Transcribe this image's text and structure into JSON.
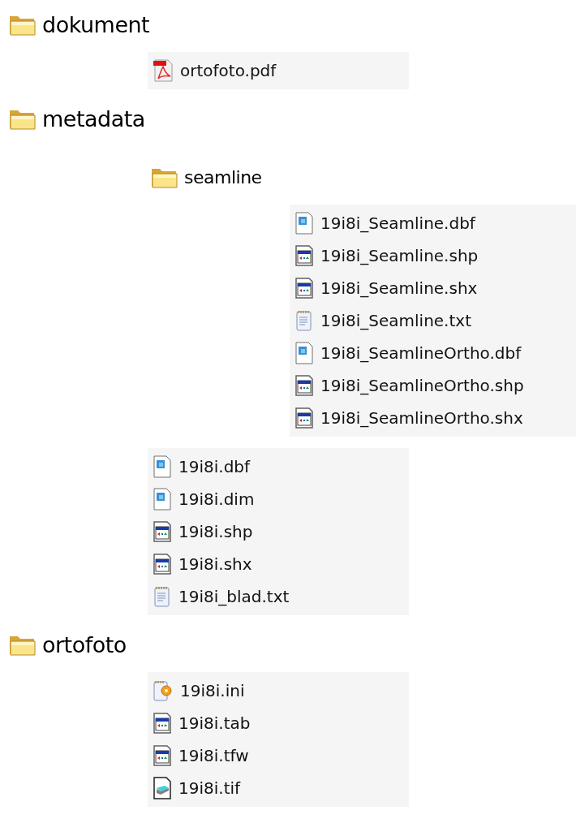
{
  "tree": [
    {
      "name": "dokument",
      "files": [
        {
          "name": "ortofoto.pdf",
          "kind": "pdf"
        }
      ]
    },
    {
      "name": "metadata",
      "children": [
        {
          "name": "seamline",
          "files": [
            {
              "name": "19i8i_Seamline.dbf",
              "kind": "dbf"
            },
            {
              "name": "19i8i_Seamline.shp",
              "kind": "map"
            },
            {
              "name": "19i8i_Seamline.shx",
              "kind": "map"
            },
            {
              "name": "19i8i_Seamline.txt",
              "kind": "txt"
            },
            {
              "name": "19i8i_SeamlineOrtho.dbf",
              "kind": "dbf"
            },
            {
              "name": "19i8i_SeamlineOrtho.shp",
              "kind": "map"
            },
            {
              "name": "19i8i_SeamlineOrtho.shx",
              "kind": "map"
            }
          ]
        }
      ],
      "files": [
        {
          "name": "19i8i.dbf",
          "kind": "dbf"
        },
        {
          "name": "19i8i.dim",
          "kind": "dbf"
        },
        {
          "name": "19i8i.shp",
          "kind": "map"
        },
        {
          "name": "19i8i.shx",
          "kind": "map"
        },
        {
          "name": "19i8i_blad.txt",
          "kind": "txt"
        }
      ]
    },
    {
      "name": "ortofoto",
      "files": [
        {
          "name": "19i8i.ini",
          "kind": "ini"
        },
        {
          "name": "19i8i.tab",
          "kind": "map"
        },
        {
          "name": "19i8i.tfw",
          "kind": "map"
        },
        {
          "name": "19i8i.tif",
          "kind": "tif"
        }
      ]
    }
  ]
}
